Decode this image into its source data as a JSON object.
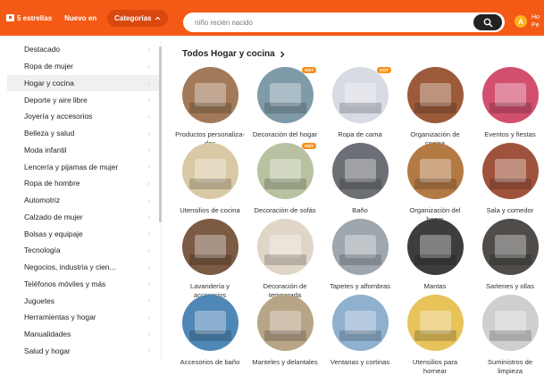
{
  "topbar": {
    "stars_label": "5 estrellas",
    "new_label": "Nuevo en",
    "categories_label": "Categorías",
    "search_placeholder": "niño recién nacido",
    "avatar_letter": "A",
    "account_text": [
      "Ho",
      "Pe"
    ],
    "brand_color": "#f45a16"
  },
  "sidebar": {
    "items": [
      {
        "label": "Destacado"
      },
      {
        "label": "Ropa de mujer"
      },
      {
        "label": "Hogar y cocina"
      },
      {
        "label": "Deporte y aire libre"
      },
      {
        "label": "Joyería y accesorios"
      },
      {
        "label": "Belleza y salud"
      },
      {
        "label": "Moda infantil"
      },
      {
        "label": "Lencería y pijamas de mujer"
      },
      {
        "label": "Ropa de hombre"
      },
      {
        "label": "Automotriz"
      },
      {
        "label": "Calzado de mujer"
      },
      {
        "label": "Bolsas y equipaje"
      },
      {
        "label": "Tecnología"
      },
      {
        "label": "Negocios, industria y cien..."
      },
      {
        "label": "Teléfonos móviles y más"
      },
      {
        "label": "Juguetes"
      },
      {
        "label": "Herramientas y hogar"
      },
      {
        "label": "Manualidades"
      },
      {
        "label": "Salud y hogar"
      }
    ],
    "active_item": "Hogar y cocina"
  },
  "main": {
    "heading": "Todos Hogar y cocina",
    "hot_badge": "HOT",
    "categories": [
      {
        "label": "Productos personaliza- dos",
        "hot": false,
        "color": "#a27a5a"
      },
      {
        "label": "Decoración del hogar",
        "hot": true,
        "color": "#7f9aa8"
      },
      {
        "label": "Ropa de cama",
        "hot": true,
        "color": "#d8dbe3"
      },
      {
        "label": "Organización de cocina",
        "hot": false,
        "color": "#9c5a3a"
      },
      {
        "label": "Eventos y fiestas",
        "hot": false,
        "color": "#d24f6e"
      },
      {
        "label": "Utensilios de cocina",
        "hot": false,
        "color": "#d9c9a4"
      },
      {
        "label": "Decoración de sofás",
        "hot": true,
        "color": "#b8c2a0"
      },
      {
        "label": "Baño",
        "hot": false,
        "color": "#6d6f76"
      },
      {
        "label": "Organización del hogar",
        "hot": false,
        "color": "#b47a44"
      },
      {
        "label": "Sala y comedor",
        "hot": false,
        "color": "#a0533c"
      },
      {
        "label": "Lavandería y accesorios",
        "hot": false,
        "color": "#7c5a44"
      },
      {
        "label": "Decoración de temporada",
        "hot": false,
        "color": "#e0d6c8"
      },
      {
        "label": "Tapetes y alfombras",
        "hot": false,
        "color": "#9ea6ae"
      },
      {
        "label": "Mantas",
        "hot": false,
        "color": "#3d3d3d"
      },
      {
        "label": "Sartenes y ollas",
        "hot": false,
        "color": "#4f4c49"
      },
      {
        "label": "Accesorios de baño",
        "hot": false,
        "color": "#4f87b7"
      },
      {
        "label": "Manteles y delantales",
        "hot": false,
        "color": "#b8a486"
      },
      {
        "label": "Ventanas y cortinas",
        "hot": false,
        "color": "#8fb0cf"
      },
      {
        "label": "Utensilios para hornear",
        "hot": false,
        "color": "#e7c35a"
      },
      {
        "label": "Suministros de limpieza",
        "hot": false,
        "color": "#cfcfcf"
      }
    ]
  }
}
